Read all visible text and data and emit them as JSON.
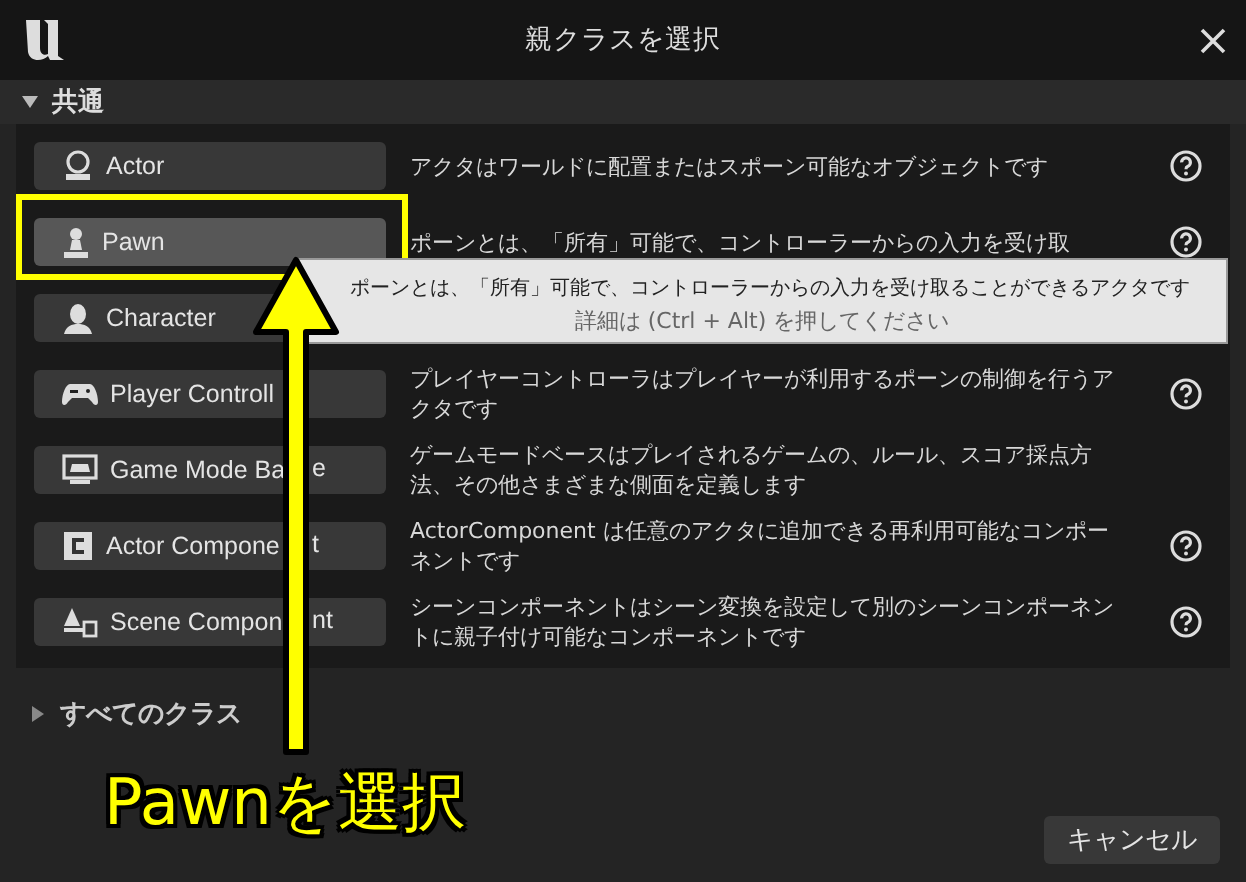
{
  "window": {
    "title": "親クラスを選択"
  },
  "section": {
    "label": "共通",
    "expanded": true
  },
  "rows": [
    {
      "label": "Actor",
      "description": "アクタはワールドに配置またはスポーン可能なオブジェクトです",
      "selected": false,
      "highlighted": false,
      "help": true
    },
    {
      "label": "Pawn",
      "description": "ポーンとは、「所有」可能で、コントローラーからの入力を受け取",
      "selected": true,
      "highlighted": true,
      "help": true
    },
    {
      "label": "Character",
      "selected": false,
      "highlighted": false,
      "help": false
    },
    {
      "label": "Player Controll",
      "description": "プレイヤーコントローラはプレイヤーが利用するポーンの制御を行うアクタです",
      "selected": false,
      "highlighted": false,
      "help": true
    },
    {
      "label": "Game Mode Ba",
      "label_tail": "e",
      "description": "ゲームモードベースはプレイされるゲームの、ルール、スコア採点方法、その他さまざまな側面を定義します",
      "selected": false,
      "highlighted": false,
      "help": false
    },
    {
      "label": "Actor Compone",
      "label_tail": "t",
      "description": "ActorComponent は任意のアクタに追加できる再利用可能なコンポーネントです",
      "selected": false,
      "highlighted": false,
      "help": true
    },
    {
      "label": "Scene Compon",
      "label_tail": "nt",
      "description": "シーンコンポーネントはシーン変換を設定して別のシーンコンポーネントに親子付け可能なコンポーネントです",
      "selected": false,
      "highlighted": false,
      "help": true
    }
  ],
  "tooltip": {
    "text": "ポーンとは、「所有」可能で、コントローラーからの入力を受け取ることができるアクタです",
    "hint": "詳細は (Ctrl + Alt) を押してください"
  },
  "all_classes": {
    "label": "すべてのクラス",
    "expanded": false
  },
  "cancel_button": "キャンセル",
  "annotation": {
    "caption": "Pawnを選択"
  }
}
